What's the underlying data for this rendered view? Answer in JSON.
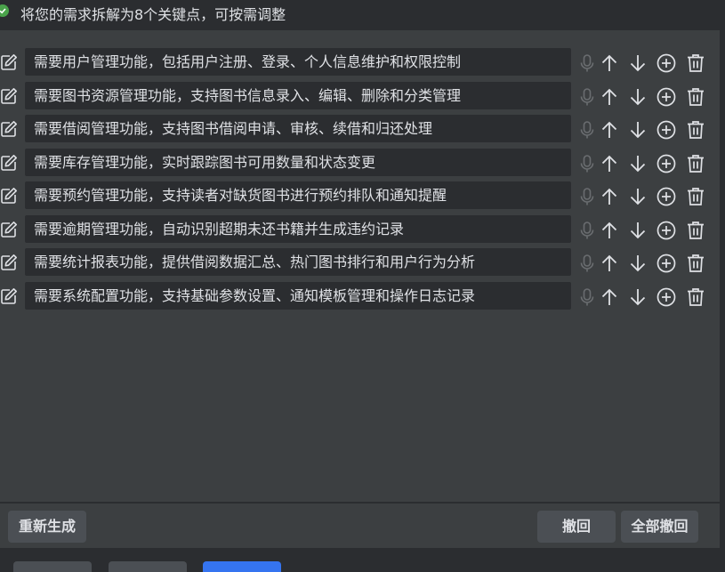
{
  "header": {
    "title": "将您的需求拆解为8个关键点，可按需调整",
    "status_icon": "check-circle-icon",
    "status_color": "#4aa34b"
  },
  "items": [
    {
      "text": "需要用户管理功能，包括用户注册、登录、个人信息维护和权限控制"
    },
    {
      "text": "需要图书资源管理功能，支持图书信息录入、编辑、删除和分类管理"
    },
    {
      "text": "需要借阅管理功能，支持图书借阅申请、审核、续借和归还处理"
    },
    {
      "text": "需要库存管理功能，实时跟踪图书可用数量和状态变更"
    },
    {
      "text": "需要预约管理功能，支持读者对缺货图书进行预约排队和通知提醒"
    },
    {
      "text": "需要逾期管理功能，自动识别超期未还书籍并生成违约记录"
    },
    {
      "text": "需要统计报表功能，提供借阅数据汇总、热门图书排行和用户行为分析"
    },
    {
      "text": "需要系统配置功能，支持基础参数设置、通知模板管理和操作日志记录"
    }
  ],
  "row_icons": [
    "edit-icon",
    "microphone-icon",
    "arrow-up-icon",
    "arrow-down-icon",
    "add-circle-icon",
    "trash-icon"
  ],
  "actions": {
    "regenerate_label": "重新生成",
    "undo_label": "撤回",
    "undo_all_label": "全部撤回"
  },
  "colors": {
    "panel_bg": "#3c3f41",
    "field_bg": "#2b2d30",
    "button_bg": "#4b4f54",
    "primary": "#3574f0"
  }
}
